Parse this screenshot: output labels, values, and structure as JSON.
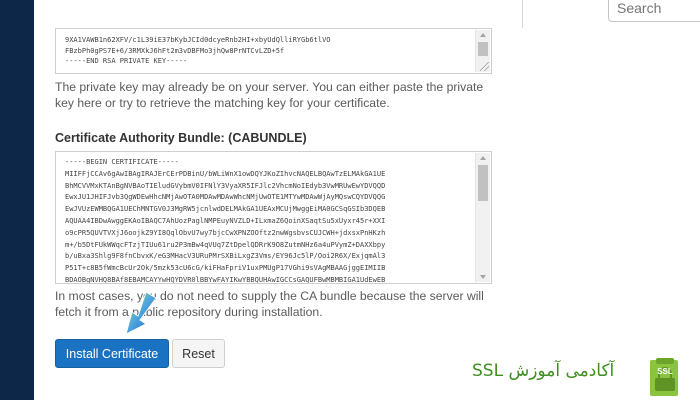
{
  "search": {
    "placeholder": "Search"
  },
  "private_key": {
    "lines": [
      "9XA1VAWB1n62XFV/c1L39iE37bKybJCId0dcyeRnb2HI+xbyUdQlliRYGb6tlVO",
      "FBzbPh0gPS7E+6/3RMXkJ6hFt2m3vDBFMo3jhQw8PrNTCvLZD+5f",
      "-----END RSA PRIVATE KEY-----"
    ],
    "help": "The private key may already be on your server. You can either paste the private key here or try to retrieve the matching key for your certificate."
  },
  "cabundle": {
    "label": "Certificate Authority Bundle: (CABUNDLE)",
    "lines": [
      "-----BEGIN CERTIFICATE-----",
      "MIIFFjCCAv6gAwIBAgIRAJErCErPDBinU/bWLiWnX1owDQYJKoZIhvcNAQELBQAwTzELMAkGA1UE",
      "BhMCVVMxKTAnBgNVBAoTIEludGVybmV0IFNlY3VyaXR5IFJlc2VhcmNoIEdyb3VwMRUwEwYDVQQD",
      "EwxJU1JHIFJvb3QgWDEwHhcNMjAwOTA0MDAwMDAwWhcNMjUwOTE1MTYwMDAwWjAyMQswCQYDVQQG",
      "EwJVUzEWMBQGA1UEChMNTGV0J3MgRW5jcnlwdDELMAkGA1UEAxMCUjMwggEiMA0GCSqGSIb3DQEB",
      "AQUAA4IBDwAwggEKAoIBAQC7AhUozPaglNMPEuyNVZLD+ILxmaZ6QoinXSaqtSu5xUyxr45r+XXI",
      "o9cPR5QUVTVXjJ6oojkZ9YI8QqlObvU7wy7bjcCwXPNZOOftz2nwWgsbvsCUJCWH+jdxsxPnHKzh",
      "m+/b5DtFUkWWqcFTzjTIUu61ru2P3mBw4qVUq7ZtDpelQDRrK9O8ZutmNHz6a4uPVymZ+DAXXbpy",
      "b/uBxa3Shlg9F8fnCbvxK/eG3MHacV3URuPMrSXBiLxgZ3Vms/EY96Jc5lP/Ooi2R6X/ExjqmAl3",
      "P51T+c8B5fWmcBcUr2Ok/5mzk53cU6cG/kiFHaFpriV1uxPMUgP17VGhi9sVAgMBAAGjggEIMIIB",
      "BDAOBgNVHQ8BAf8EBAMCAYYwHQYDVR0lBBYwFAYIKwYBBQUHAwIGCCsGAQUFBwMBMBIGA1UdEwEB"
    ],
    "help": "In most cases, you do not need to supply the CA bundle because the server will fetch it from a public repository during installation."
  },
  "buttons": {
    "install": "Install Certificate",
    "reset": "Reset"
  },
  "brand": {
    "text": "آکادمی آموزش SSL",
    "badge": "SSL"
  },
  "colors": {
    "sidebar": "#0d2748",
    "primary": "#1a73c2",
    "brand_green": "#3d8f1f",
    "badge_green": "#8ac43f"
  }
}
